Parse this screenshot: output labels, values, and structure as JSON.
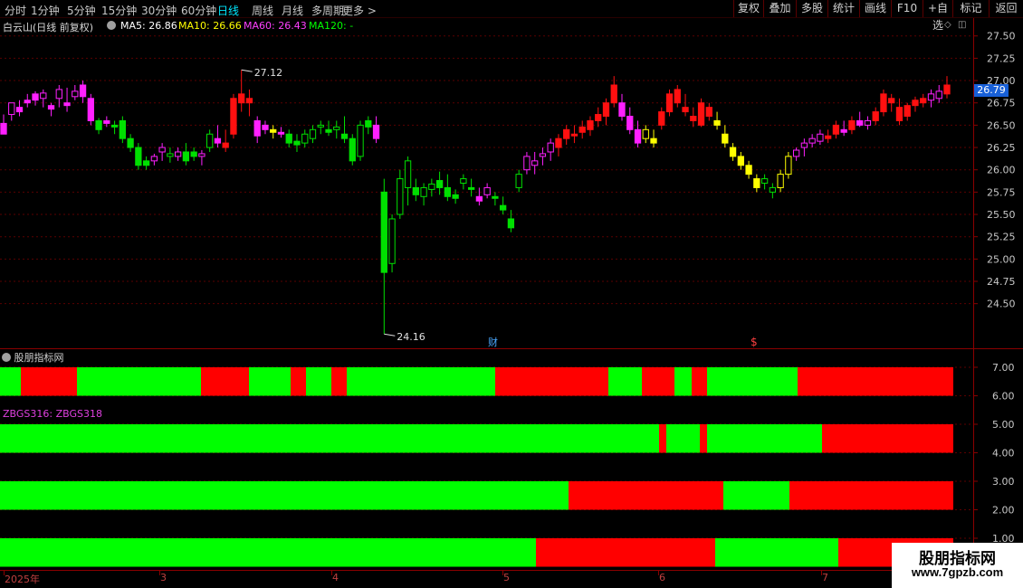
{
  "toolbar": {
    "timeframes": [
      "分时",
      "1分钟",
      "5分钟",
      "15分钟",
      "30分钟",
      "60分钟",
      "日线",
      "周线",
      "月线",
      "多周期",
      "更多 >"
    ],
    "active_timeframe": "日线",
    "right_buttons": [
      "复权",
      "叠加",
      "多股",
      "统计",
      "画线",
      "F10",
      "+自选",
      "标记",
      "返回"
    ]
  },
  "info": {
    "stock_title": "白云山(日线 前复权)",
    "ma5": "MA5: 26.86",
    "ma10": "MA10: 26.66",
    "ma60": "MA60: 26.43",
    "ma120": "MA120: -",
    "colors": {
      "ma5": "#ffffff",
      "ma10": "#ffff00",
      "ma60": "#ff40ff",
      "ma120": "#00ff00"
    }
  },
  "price_axis": {
    "ticks": [
      "27.50",
      "27.25",
      "27.00",
      "26.75",
      "26.50",
      "26.25",
      "26.00",
      "25.75",
      "25.50",
      "25.25",
      "25.00",
      "24.75",
      "24.50"
    ],
    "current_price": "26.79"
  },
  "annotations": {
    "high_label": "27.12",
    "low_label": "24.16",
    "cai_marker": "财",
    "dollar_marker": "$"
  },
  "indicator": {
    "title": "股朋指标网",
    "formula_label": "ZBGS316: ZBGS318",
    "axis_ticks": [
      "7.00",
      "6.00",
      "5.00",
      "4.00",
      "3.00",
      "2.00",
      "1.00"
    ],
    "rows": [
      {
        "name": "row1",
        "y_top": 7.0,
        "y_bottom": 6.0,
        "segments": [
          [
            "g",
            0,
            23
          ],
          [
            "r",
            23,
            85
          ],
          [
            "g",
            85,
            222
          ],
          [
            "r",
            222,
            275
          ],
          [
            "g",
            275,
            321
          ],
          [
            "r",
            321,
            338
          ],
          [
            "g",
            338,
            366
          ],
          [
            "r",
            366,
            383
          ],
          [
            "g",
            383,
            547
          ],
          [
            "r",
            547,
            672
          ],
          [
            "g",
            672,
            709
          ],
          [
            "r",
            709,
            745
          ],
          [
            "g",
            745,
            764
          ],
          [
            "r",
            764,
            781
          ],
          [
            "g",
            781,
            881
          ],
          [
            "r",
            881,
            1053
          ]
        ]
      },
      {
        "name": "row2",
        "y_top": 5.0,
        "y_bottom": 4.0,
        "segments": [
          [
            "g",
            0,
            728
          ],
          [
            "r",
            728,
            736
          ],
          [
            "g",
            736,
            773
          ],
          [
            "r",
            773,
            781
          ],
          [
            "g",
            781,
            908
          ],
          [
            "r",
            908,
            1053
          ]
        ]
      },
      {
        "name": "row3",
        "y_top": 3.0,
        "y_bottom": 2.0,
        "segments": [
          [
            "g",
            0,
            628
          ],
          [
            "r",
            628,
            799
          ],
          [
            "g",
            799,
            872
          ],
          [
            "r",
            872,
            1053
          ]
        ]
      },
      {
        "name": "row4",
        "y_top": 1.0,
        "y_bottom": 0.0,
        "segments": [
          [
            "g",
            0,
            592
          ],
          [
            "r",
            592,
            790
          ],
          [
            "g",
            790,
            926
          ],
          [
            "r",
            926,
            1053
          ]
        ]
      }
    ]
  },
  "date_axis": {
    "labels": [
      "2025年",
      "3",
      "4",
      "5",
      "6",
      "7"
    ]
  },
  "watermark": {
    "line1": "股朋指标网",
    "line2": "www.7gpzb.com"
  },
  "chart_data": {
    "type": "candlestick",
    "ylim": [
      24.0,
      27.7
    ],
    "candles": [
      [
        26.52,
        26.62,
        26.45,
        26.4,
        "m"
      ],
      [
        26.62,
        26.7,
        26.55,
        26.75,
        "m"
      ],
      [
        26.7,
        26.78,
        26.6,
        26.65,
        "m"
      ],
      [
        26.78,
        26.85,
        26.7,
        26.75,
        "m"
      ],
      [
        26.85,
        26.88,
        26.72,
        26.78,
        "m"
      ],
      [
        26.8,
        26.9,
        26.7,
        26.86,
        "m"
      ],
      [
        26.72,
        26.75,
        26.6,
        26.68,
        "m"
      ],
      [
        26.8,
        26.95,
        26.7,
        26.9,
        "m"
      ],
      [
        26.75,
        26.92,
        26.65,
        26.72,
        "m"
      ],
      [
        26.82,
        26.95,
        26.78,
        26.88,
        "m"
      ],
      [
        26.95,
        27.0,
        26.75,
        26.82,
        "m"
      ],
      [
        26.8,
        26.85,
        26.5,
        26.55,
        "m"
      ],
      [
        26.55,
        26.58,
        26.4,
        26.45,
        "g"
      ],
      [
        26.55,
        26.6,
        26.48,
        26.52,
        "m"
      ],
      [
        26.5,
        26.55,
        26.4,
        26.48,
        "g"
      ],
      [
        26.55,
        26.6,
        26.3,
        26.35,
        "g"
      ],
      [
        26.35,
        26.4,
        26.2,
        26.25,
        "g"
      ],
      [
        26.25,
        26.3,
        26.0,
        26.05,
        "g"
      ],
      [
        26.1,
        26.15,
        26.0,
        26.05,
        "g"
      ],
      [
        26.1,
        26.18,
        26.05,
        26.15,
        "m"
      ],
      [
        26.2,
        26.3,
        26.1,
        26.25,
        "m"
      ],
      [
        26.15,
        26.25,
        26.08,
        26.18,
        "g"
      ],
      [
        26.15,
        26.25,
        26.1,
        26.2,
        "m"
      ],
      [
        26.2,
        26.3,
        26.05,
        26.1,
        "g"
      ],
      [
        26.2,
        26.25,
        26.1,
        26.15,
        "g"
      ],
      [
        26.15,
        26.22,
        26.05,
        26.18,
        "m"
      ],
      [
        26.25,
        26.45,
        26.2,
        26.4,
        "g"
      ],
      [
        26.35,
        26.5,
        26.25,
        26.3,
        "m"
      ],
      [
        26.3,
        26.45,
        26.2,
        26.25,
        "r"
      ],
      [
        26.4,
        26.85,
        26.35,
        26.8,
        "r"
      ],
      [
        26.75,
        27.12,
        26.65,
        26.85,
        "r"
      ],
      [
        26.8,
        26.9,
        26.6,
        26.75,
        "r"
      ],
      [
        26.55,
        26.6,
        26.3,
        26.38,
        "m"
      ],
      [
        26.5,
        26.55,
        26.4,
        26.45,
        "m"
      ],
      [
        26.45,
        26.5,
        26.35,
        26.42,
        "y"
      ],
      [
        26.42,
        26.48,
        26.36,
        26.4,
        "m"
      ],
      [
        26.4,
        26.45,
        26.25,
        26.3,
        "g"
      ],
      [
        26.32,
        26.4,
        26.2,
        26.28,
        "g"
      ],
      [
        26.3,
        26.45,
        26.25,
        26.4,
        "g"
      ],
      [
        26.35,
        26.5,
        26.3,
        26.45,
        "g"
      ],
      [
        26.48,
        26.55,
        26.4,
        26.5,
        "g"
      ],
      [
        26.45,
        26.55,
        26.38,
        26.42,
        "g"
      ],
      [
        26.45,
        26.55,
        26.35,
        26.48,
        "g"
      ],
      [
        26.4,
        26.6,
        26.3,
        26.35,
        "g"
      ],
      [
        26.35,
        26.4,
        26.05,
        26.1,
        "g"
      ],
      [
        26.15,
        26.55,
        26.1,
        26.5,
        "g"
      ],
      [
        26.55,
        26.6,
        26.4,
        26.48,
        "g"
      ],
      [
        26.5,
        26.6,
        26.3,
        26.35,
        "m"
      ],
      [
        25.75,
        25.9,
        24.16,
        24.85,
        "g"
      ],
      [
        24.95,
        25.5,
        24.85,
        25.45,
        "g"
      ],
      [
        25.5,
        26.0,
        25.45,
        25.9,
        "g"
      ],
      [
        25.8,
        26.15,
        25.6,
        26.1,
        "g"
      ],
      [
        25.8,
        25.9,
        25.65,
        25.72,
        "g"
      ],
      [
        25.7,
        25.85,
        25.6,
        25.8,
        "g"
      ],
      [
        25.78,
        25.9,
        25.7,
        25.84,
        "g"
      ],
      [
        25.88,
        25.98,
        25.72,
        25.8,
        "g"
      ],
      [
        25.8,
        25.95,
        25.65,
        25.7,
        "g"
      ],
      [
        25.72,
        25.78,
        25.62,
        25.68,
        "g"
      ],
      [
        25.85,
        25.95,
        25.78,
        25.9,
        "g"
      ],
      [
        25.8,
        25.9,
        25.7,
        25.78,
        "g"
      ],
      [
        25.7,
        25.8,
        25.6,
        25.65,
        "m"
      ],
      [
        25.72,
        25.85,
        25.68,
        25.8,
        "m"
      ],
      [
        25.7,
        25.75,
        25.6,
        25.68,
        "g"
      ],
      [
        25.6,
        25.7,
        25.5,
        25.55,
        "g"
      ],
      [
        25.45,
        25.55,
        25.3,
        25.35,
        "g"
      ],
      [
        25.8,
        26.0,
        25.75,
        25.95,
        "g"
      ],
      [
        26.0,
        26.2,
        25.95,
        26.15,
        "m"
      ],
      [
        26.05,
        26.2,
        25.95,
        26.1,
        "m"
      ],
      [
        26.15,
        26.25,
        26.05,
        26.18,
        "m"
      ],
      [
        26.2,
        26.35,
        26.1,
        26.3,
        "m"
      ],
      [
        26.25,
        26.4,
        26.15,
        26.35,
        "r"
      ],
      [
        26.35,
        26.5,
        26.28,
        26.45,
        "r"
      ],
      [
        26.4,
        26.5,
        26.3,
        26.38,
        "r"
      ],
      [
        26.42,
        26.55,
        26.35,
        26.48,
        "r"
      ],
      [
        26.45,
        26.6,
        26.38,
        26.55,
        "r"
      ],
      [
        26.55,
        26.7,
        26.48,
        26.62,
        "r"
      ],
      [
        26.6,
        26.8,
        26.5,
        26.75,
        "r"
      ],
      [
        26.75,
        27.05,
        26.7,
        26.95,
        "r"
      ],
      [
        26.75,
        26.85,
        26.55,
        26.6,
        "m"
      ],
      [
        26.6,
        26.7,
        26.4,
        26.45,
        "m"
      ],
      [
        26.45,
        26.55,
        26.25,
        26.3,
        "m"
      ],
      [
        26.35,
        26.5,
        26.3,
        26.45,
        "y"
      ],
      [
        26.35,
        26.45,
        26.25,
        26.3,
        "y"
      ],
      [
        26.5,
        26.7,
        26.45,
        26.65,
        "r"
      ],
      [
        26.65,
        26.9,
        26.6,
        26.85,
        "r"
      ],
      [
        26.75,
        26.95,
        26.7,
        26.9,
        "r"
      ],
      [
        26.7,
        26.85,
        26.6,
        26.65,
        "r"
      ],
      [
        26.55,
        26.7,
        26.48,
        26.6,
        "r"
      ],
      [
        26.5,
        26.8,
        26.48,
        26.75,
        "r"
      ],
      [
        26.6,
        26.75,
        26.55,
        26.7,
        "r"
      ],
      [
        26.55,
        26.65,
        26.45,
        26.5,
        "y"
      ],
      [
        26.4,
        26.5,
        26.25,
        26.3,
        "y"
      ],
      [
        26.25,
        26.3,
        26.1,
        26.15,
        "y"
      ],
      [
        26.15,
        26.2,
        26.0,
        26.05,
        "y"
      ],
      [
        26.05,
        26.1,
        25.9,
        25.95,
        "y"
      ],
      [
        25.9,
        25.95,
        25.75,
        25.8,
        "y"
      ],
      [
        25.85,
        25.95,
        25.78,
        25.9,
        "g"
      ],
      [
        25.75,
        25.85,
        25.68,
        25.8,
        "g"
      ],
      [
        25.8,
        26.0,
        25.75,
        25.95,
        "y"
      ],
      [
        25.95,
        26.2,
        25.9,
        26.15,
        "y"
      ],
      [
        26.15,
        26.25,
        26.1,
        26.22,
        "m"
      ],
      [
        26.25,
        26.35,
        26.15,
        26.3,
        "m"
      ],
      [
        26.3,
        26.4,
        26.25,
        26.35,
        "m"
      ],
      [
        26.32,
        26.45,
        26.28,
        26.4,
        "m"
      ],
      [
        26.38,
        26.45,
        26.3,
        26.35,
        "r"
      ],
      [
        26.4,
        26.55,
        26.35,
        26.5,
        "r"
      ],
      [
        26.45,
        26.55,
        26.38,
        26.42,
        "m"
      ],
      [
        26.45,
        26.6,
        26.4,
        26.55,
        "r"
      ],
      [
        26.55,
        26.65,
        26.48,
        26.5,
        "m"
      ],
      [
        26.5,
        26.6,
        26.45,
        26.55,
        "m"
      ],
      [
        26.55,
        26.7,
        26.5,
        26.65,
        "r"
      ],
      [
        26.65,
        26.9,
        26.6,
        26.85,
        "r"
      ],
      [
        26.75,
        26.85,
        26.65,
        26.8,
        "r"
      ],
      [
        26.7,
        26.8,
        26.5,
        26.55,
        "r"
      ],
      [
        26.6,
        26.75,
        26.55,
        26.72,
        "r"
      ],
      [
        26.72,
        26.82,
        26.65,
        26.78,
        "r"
      ],
      [
        26.75,
        26.85,
        26.7,
        26.8,
        "r"
      ],
      [
        26.78,
        26.9,
        26.7,
        26.85,
        "m"
      ],
      [
        26.8,
        26.95,
        26.75,
        26.88,
        "m"
      ],
      [
        26.85,
        27.05,
        26.8,
        26.95,
        "r"
      ]
    ]
  }
}
